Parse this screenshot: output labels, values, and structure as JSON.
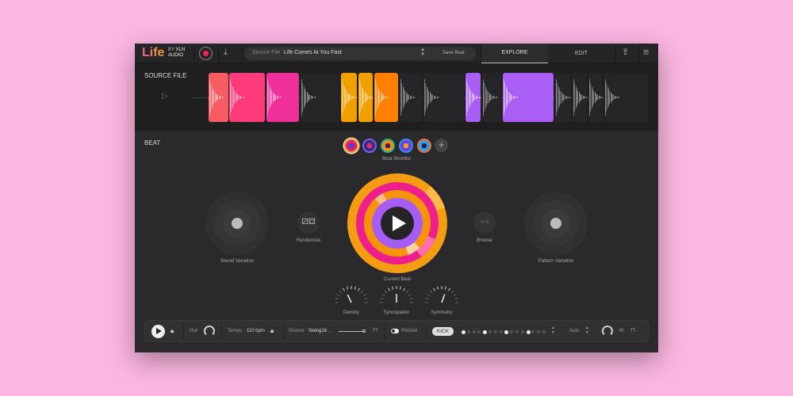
{
  "header": {
    "logo": "Life",
    "by": "BY",
    "brand": "XLN",
    "brand2": "AUDIO",
    "source_label": "Source File",
    "source_value": "Life Comes At You Fast",
    "save_beat": "Save Beat",
    "tabs": [
      {
        "label": "EXPLORE",
        "active": true
      },
      {
        "label": "EDIT",
        "active": false
      }
    ]
  },
  "source": {
    "title": "SOURCE FILE"
  },
  "beat": {
    "title": "BEAT",
    "shortlist_label": "Beat Shortlist",
    "current_beat": "Current Beat",
    "sound_variation": "Sound Variation",
    "pattern_variation": "Pattern Variation",
    "randomize": "Randomize",
    "browse": "Browse",
    "knobs": [
      {
        "label": "Density"
      },
      {
        "label": "Syncopation"
      },
      {
        "label": "Symmetry"
      }
    ]
  },
  "bottom": {
    "out": "Out",
    "tempo_label": "Tempo",
    "tempo": "110 bpm",
    "groove_label": "Groove",
    "groove": "Swing16",
    "pitched": "Pitched",
    "instrument": "KICK",
    "steps": [
      1,
      0,
      0,
      0,
      1,
      0,
      0,
      0,
      1,
      0,
      0,
      0,
      1,
      0,
      0,
      0
    ],
    "auto": "Auto",
    "m": "M"
  },
  "colors": {
    "bg": "#fbb6e1",
    "coral": "#f75c63",
    "pink": "#ff3a7a",
    "magenta": "#f0309a",
    "amber": "#f0a000",
    "orange": "#ff8000",
    "purple": "#a95ff6"
  }
}
